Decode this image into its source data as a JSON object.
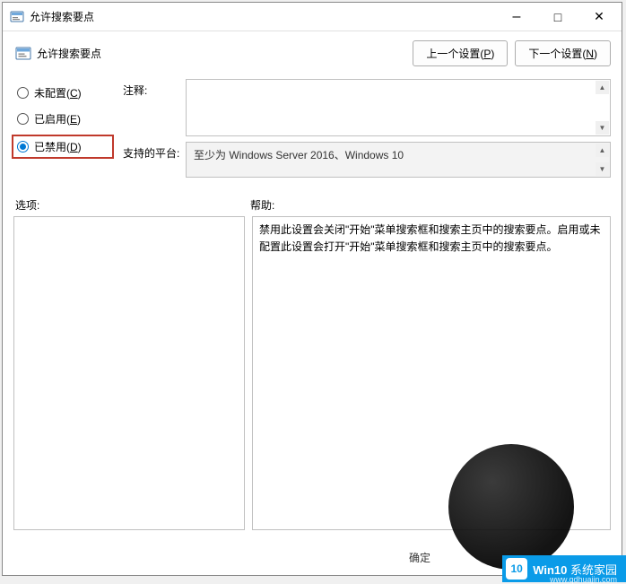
{
  "window": {
    "title": "允许搜索要点"
  },
  "header": {
    "policy_name": "允许搜索要点",
    "prev_button": "上一个设置(",
    "prev_accel": "P",
    "prev_suffix": ")",
    "next_button": "下一个设置(",
    "next_accel": "N",
    "next_suffix": ")"
  },
  "radios": {
    "not_configured_label": "未配置(",
    "not_configured_accel": "C",
    "not_configured_suffix": ")",
    "enabled_label": "已启用(",
    "enabled_accel": "E",
    "enabled_suffix": ")",
    "disabled_label": "已禁用(",
    "disabled_accel": "D",
    "disabled_suffix": ")"
  },
  "fields": {
    "comment_label": "注释:",
    "comment_value": "",
    "platform_label": "支持的平台:",
    "platform_value": "至少为 Windows Server 2016、Windows 10"
  },
  "lower": {
    "options_label": "选项:",
    "help_label": "帮助:",
    "help_text": "禁用此设置会关闭\"开始\"菜单搜索框和搜索主页中的搜索要点。启用或未配置此设置会打开\"开始\"菜单搜索框和搜索主页中的搜索要点。"
  },
  "footer": {
    "ok": "确定"
  },
  "watermark": {
    "brand": "Win10",
    "brand2": "系统家园",
    "badge": "10",
    "url": "www.qdhuajin.com"
  }
}
